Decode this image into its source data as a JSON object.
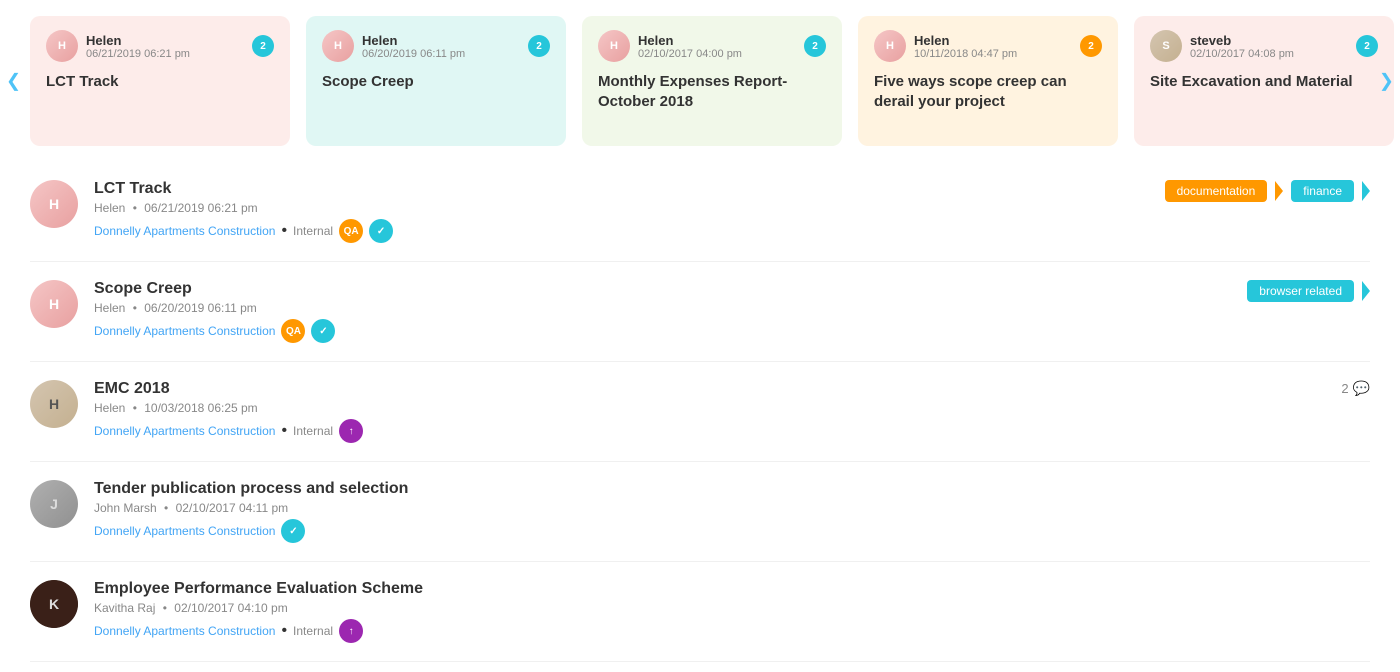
{
  "carousel": {
    "cards": [
      {
        "id": "card-1",
        "author": "Helen",
        "date": "06/21/2019 06:21 pm",
        "title": "LCT Track",
        "bg": "pink",
        "badge_color": "teal",
        "badge_count": "2",
        "avatar_class": "avatar-helen"
      },
      {
        "id": "card-2",
        "author": "Helen",
        "date": "06/20/2019 06:11 pm",
        "title": "Scope Creep",
        "bg": "teal",
        "badge_color": "teal",
        "badge_count": "2",
        "avatar_class": "avatar-helen"
      },
      {
        "id": "card-3",
        "author": "Helen",
        "date": "02/10/2017 04:00 pm",
        "title": "Monthly Expenses Report- October 2018",
        "bg": "green",
        "badge_color": "teal",
        "badge_count": "2",
        "avatar_class": "avatar-helen"
      },
      {
        "id": "card-4",
        "author": "Helen",
        "date": "10/11/2018 04:47 pm",
        "title": "Five ways scope creep can derail your project",
        "bg": "peach",
        "badge_color": "orange",
        "badge_count": "2",
        "avatar_class": "avatar-helen"
      },
      {
        "id": "card-5",
        "author": "steveb",
        "date": "02/10/2017 04:08 pm",
        "title": "Site Excavation and Material",
        "bg": "pink",
        "badge_color": "teal",
        "badge_count": "2",
        "avatar_class": "avatar-steveb"
      }
    ]
  },
  "list": {
    "items": [
      {
        "id": "item-1",
        "title": "LCT Track",
        "author": "Helen",
        "date": "06/21/2019 06:21 pm",
        "project": "Donnelly Apartments Construction",
        "visibility": "Internal",
        "avatar_class": "avatar-helen",
        "tags": [
          {
            "label": "documentation",
            "color": "orange"
          },
          {
            "label": "finance",
            "color": "teal"
          }
        ],
        "participants": [
          {
            "initials": "QA",
            "color": "orange"
          },
          {
            "initials": "✓",
            "color": "teal"
          }
        ],
        "comment_count": null
      },
      {
        "id": "item-2",
        "title": "Scope Creep",
        "author": "Helen",
        "date": "06/20/2019 06:11 pm",
        "project": "Donnelly Apartments Construction",
        "visibility": null,
        "avatar_class": "avatar-helen",
        "tags": [
          {
            "label": "browser related",
            "color": "teal"
          }
        ],
        "participants": [
          {
            "initials": "QA",
            "color": "orange"
          },
          {
            "initials": "✓",
            "color": "teal"
          }
        ],
        "comment_count": null
      },
      {
        "id": "item-3",
        "title": "EMC 2018",
        "author": "Helen",
        "date": "10/03/2018 06:25 pm",
        "project": "Donnelly Apartments Construction",
        "visibility": "Internal",
        "avatar_class": "avatar-helen-2",
        "tags": [],
        "participants": [
          {
            "initials": "↑",
            "color": "purple"
          }
        ],
        "comment_count": "2"
      },
      {
        "id": "item-4",
        "title": "Tender publication process and selection",
        "author": "John Marsh",
        "date": "02/10/2017 04:11 pm",
        "project": "Donnelly Apartments Construction",
        "visibility": null,
        "avatar_class": "avatar-john",
        "tags": [],
        "participants": [
          {
            "initials": "✓",
            "color": "teal"
          }
        ],
        "comment_count": null
      },
      {
        "id": "item-5",
        "title": "Employee Performance Evaluation Scheme",
        "author": "Kavitha Raj",
        "date": "02/10/2017 04:10 pm",
        "project": "Donnelly Apartments Construction",
        "visibility": "Internal",
        "avatar_class": "avatar-kavitha",
        "tags": [],
        "participants": [
          {
            "initials": "↑",
            "color": "purple"
          }
        ],
        "comment_count": null
      }
    ]
  },
  "labels": {
    "internal": "Internal",
    "bullet": "•",
    "prev_arrow": "❮",
    "next_arrow": "❯"
  }
}
